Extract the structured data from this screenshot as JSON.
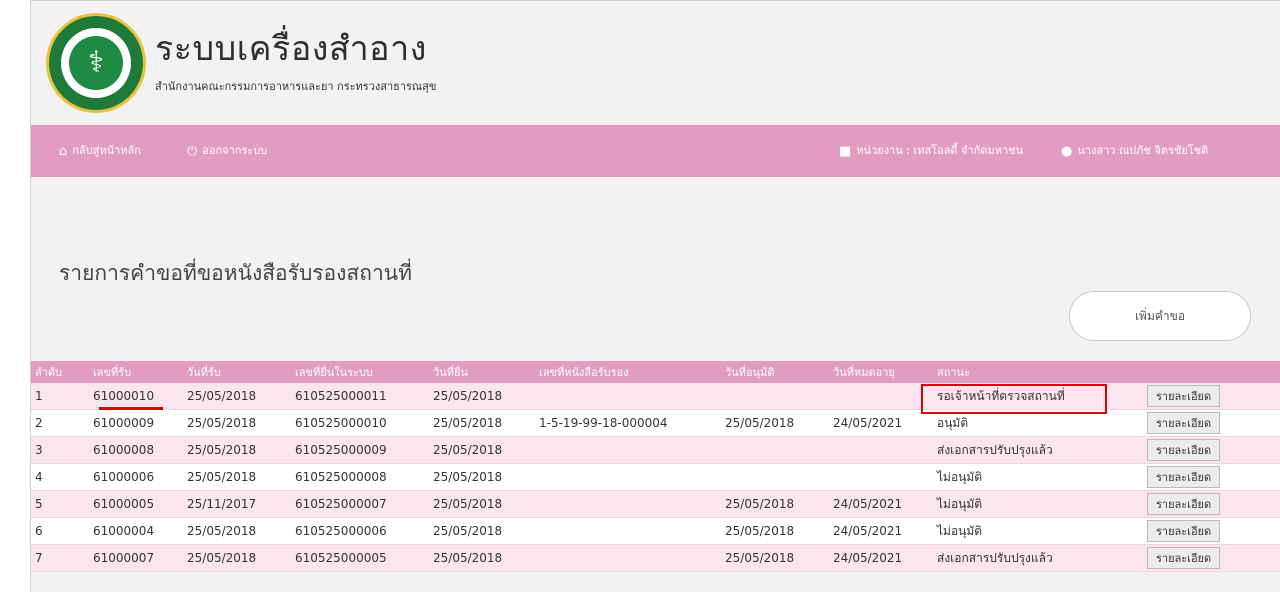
{
  "header": {
    "title": "ระบบเครื่องสำอาง",
    "subtitle": "สำนักงานคณะกรรมการอาหารและยา กระทรวงสาธารณสุข"
  },
  "nav": {
    "home": "กลับสู่หน้าหลัก",
    "logout": "ออกจากระบบ",
    "agency": "หน่วยงาน : เทสโอลดี้ จำกัดมหาชน",
    "user": "นางสาว ณปภัช จิตรชัยโชติ"
  },
  "page": {
    "heading": "รายการคำขอที่ขอหนังสือรับรองสถานที่",
    "add_button": "เพิ่มคำขอ"
  },
  "table": {
    "columns": [
      "ลำดับ",
      "เลขที่รับ",
      "วันที่รับ",
      "เลขที่ยื่นในระบบ",
      "วันที่ยื่น",
      "เลขที่หนังสือรับรอง",
      "วันที่อนุมัติ",
      "วันที่หมดอายุ",
      "สถานะ",
      ""
    ],
    "detail_label": "รายละเอียด",
    "rows": [
      {
        "no": "1",
        "receive_no": "61000010",
        "receive_date": "25/05/2018",
        "system_no": "610525000011",
        "submit_date": "25/05/2018",
        "cert_no": "",
        "approve_date": "",
        "expire_date": "",
        "status": "รอเจ้าหน้าที่ตรวจสถานที่"
      },
      {
        "no": "2",
        "receive_no": "61000009",
        "receive_date": "25/05/2018",
        "system_no": "610525000010",
        "submit_date": "25/05/2018",
        "cert_no": "1-5-19-99-18-000004",
        "approve_date": "25/05/2018",
        "expire_date": "24/05/2021",
        "status": "อนุมัติ"
      },
      {
        "no": "3",
        "receive_no": "61000008",
        "receive_date": "25/05/2018",
        "system_no": "610525000009",
        "submit_date": "25/05/2018",
        "cert_no": "",
        "approve_date": "",
        "expire_date": "",
        "status": "ส่งเอกสารปรับปรุงแล้ว"
      },
      {
        "no": "4",
        "receive_no": "61000006",
        "receive_date": "25/05/2018",
        "system_no": "610525000008",
        "submit_date": "25/05/2018",
        "cert_no": "",
        "approve_date": "",
        "expire_date": "",
        "status": "ไม่อนุมัติ"
      },
      {
        "no": "5",
        "receive_no": "61000005",
        "receive_date": "25/11/2017",
        "system_no": "610525000007",
        "submit_date": "25/05/2018",
        "cert_no": "",
        "approve_date": "25/05/2018",
        "expire_date": "24/05/2021",
        "status": "ไม่อนุมัติ"
      },
      {
        "no": "6",
        "receive_no": "61000004",
        "receive_date": "25/05/2018",
        "system_no": "610525000006",
        "submit_date": "25/05/2018",
        "cert_no": "",
        "approve_date": "25/05/2018",
        "expire_date": "24/05/2021",
        "status": "ไม่อนุมัติ"
      },
      {
        "no": "7",
        "receive_no": "61000007",
        "receive_date": "25/05/2018",
        "system_no": "610525000005",
        "submit_date": "25/05/2018",
        "cert_no": "",
        "approve_date": "25/05/2018",
        "expire_date": "24/05/2021",
        "status": "ส่งเอกสารปรับปรุงแล้ว"
      }
    ]
  },
  "colors": {
    "accent": "#e29bc1",
    "row_alt": "#fbe6ef",
    "annotation": "#e00000"
  }
}
